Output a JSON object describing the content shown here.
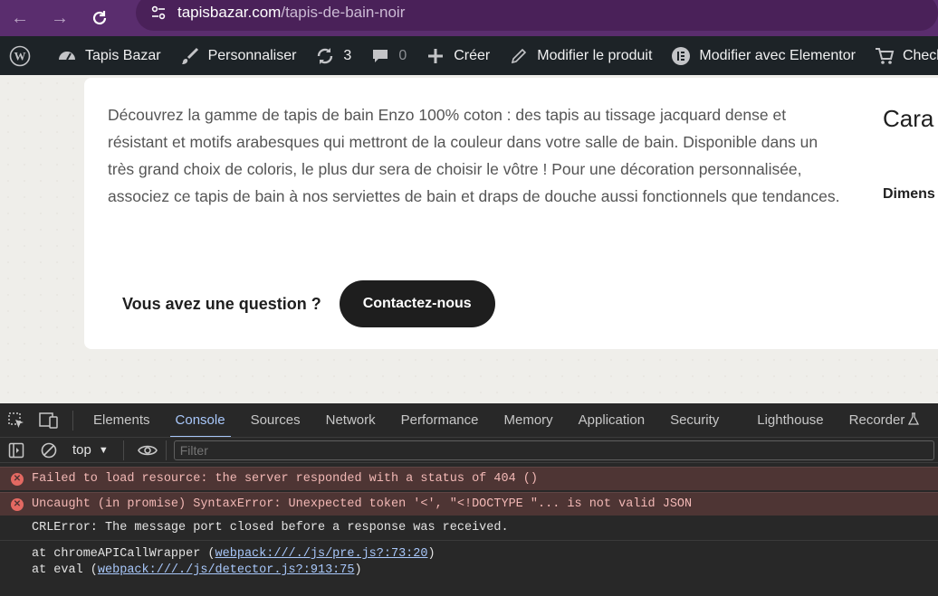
{
  "browser": {
    "url_domain": "tapisbazar.com",
    "url_path": "/tapis-de-bain-noir"
  },
  "wp_bar": {
    "site_name": "Tapis Bazar",
    "customize": "Personnaliser",
    "updates_count": "3",
    "comments_count": "0",
    "new": "Créer",
    "edit_product": "Modifier le produit",
    "edit_elementor": "Modifier avec Elementor",
    "checkout": "Checkout"
  },
  "page": {
    "description": "Découvrez la gamme de tapis de bain Enzo 100% coton : des tapis au tissage jacquard dense et résistant et motifs arabesques qui mettront de la couleur dans votre salle de bain. Disponible dans un très grand choix de coloris, le plus dur sera de choisir le vôtre ! Pour une décoration personnalisée, associez ce tapis de bain à nos serviettes de bain et draps de douche aussi fonctionnels que tendances.",
    "question": "Vous avez une question ?",
    "contact_button": "Contactez-nous",
    "side_title": "Cara",
    "side_label": "Dimens"
  },
  "devtools": {
    "tabs": [
      "Elements",
      "Console",
      "Sources",
      "Network",
      "Performance",
      "Memory",
      "Application",
      "Security",
      "Lighthouse",
      "Recorder"
    ],
    "context": "top",
    "filter_placeholder": "Filter",
    "messages": {
      "error1": "Failed to load resource: the server responded with a status of 404 ()",
      "error2": "Uncaught (in promise) SyntaxError: Unexpected token '<', \"<!DOCTYPE \"... is not valid JSON",
      "info": "CRLError: The message port closed before a response was received.",
      "trace1_prefix": "at chromeAPICallWrapper (",
      "trace1_link": "webpack:///./js/pre.js?:73:20",
      "trace1_suffix": ")",
      "trace2_prefix": "at eval (",
      "trace2_link": "webpack:///./js/detector.js?:913:75",
      "trace2_suffix": ")"
    }
  }
}
